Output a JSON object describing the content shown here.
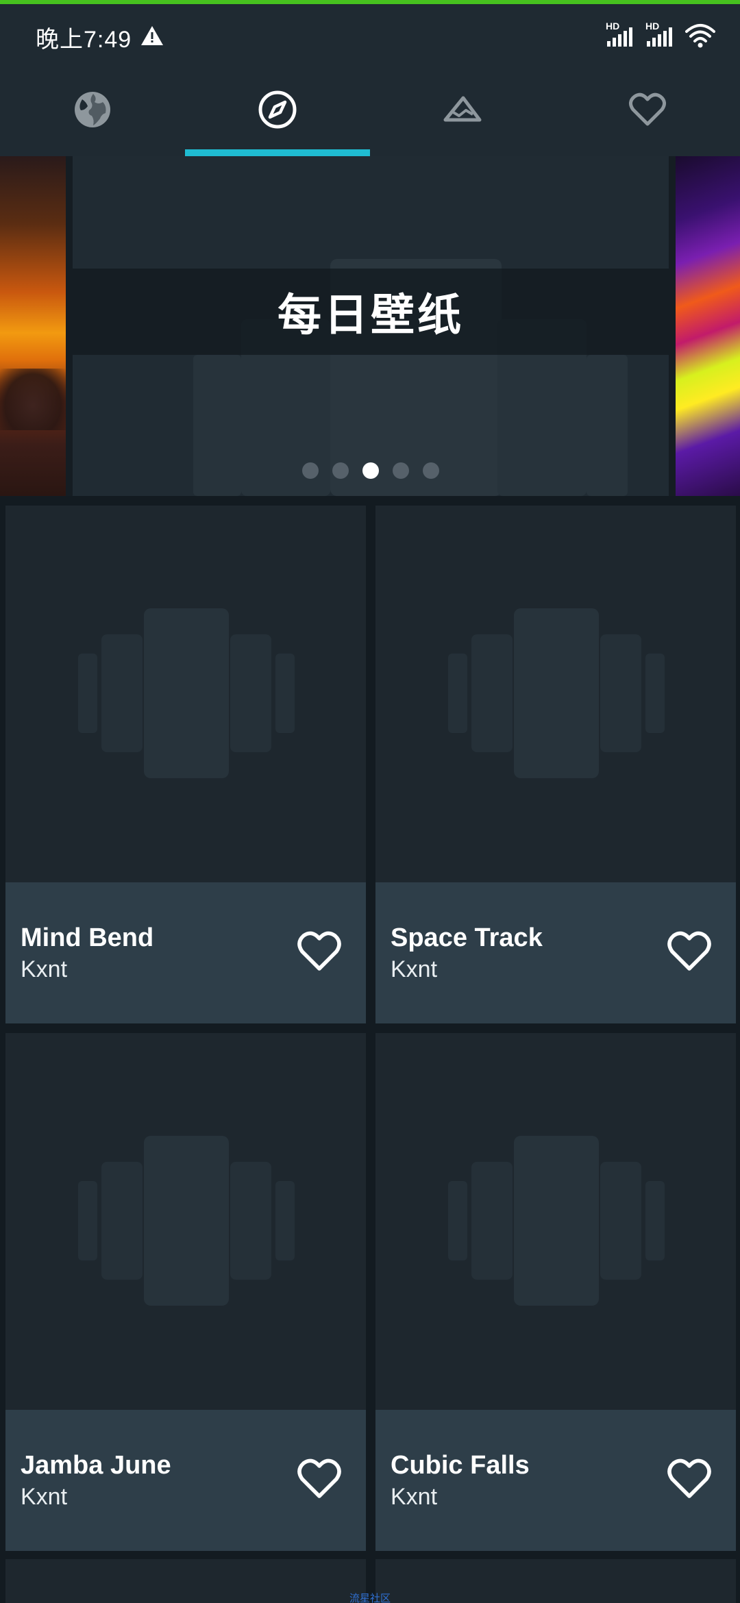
{
  "status_bar": {
    "time": "晚上7:49",
    "alert_icon": "warning-triangle-icon",
    "network_labels": [
      "HD",
      "HD"
    ],
    "wifi_icon": "wifi-icon"
  },
  "tabs": [
    {
      "icon": "globe-icon",
      "active": false
    },
    {
      "icon": "compass-icon",
      "active": true
    },
    {
      "icon": "mountain-icon",
      "active": false
    },
    {
      "icon": "heart-icon",
      "active": false
    }
  ],
  "colors": {
    "accent": "#1fbcd2",
    "progress_line": "#46c11f",
    "background": "#131b21",
    "card_footer": "#2e3e49"
  },
  "carousel": {
    "title": "每日壁纸",
    "page_count": 5,
    "active_page": 3
  },
  "cards": [
    {
      "title": "Mind Bend",
      "author": "Kxnt"
    },
    {
      "title": "Space Track",
      "author": "Kxnt"
    },
    {
      "title": "Jamba June",
      "author": "Kxnt"
    },
    {
      "title": "Cubic Falls",
      "author": "Kxnt"
    }
  ],
  "bottom_caption": "流星社区"
}
